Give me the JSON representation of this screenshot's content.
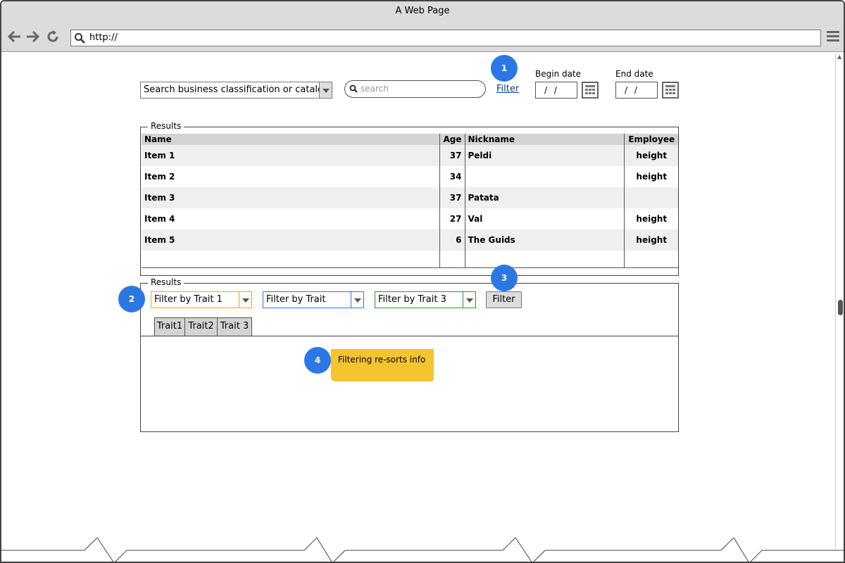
{
  "window": {
    "title": "A Web Page",
    "url": "http://"
  },
  "toolbar": {
    "classification_select": "Search business classification or catalog",
    "search_placeholder": "search",
    "filter_link": "Filter",
    "begin_date_label": "Begin date",
    "begin_date_value": "/ /",
    "end_date_label": "End date",
    "end_date_value": "/ /"
  },
  "results_table": {
    "legend": "Results",
    "columns": [
      "Name",
      "Age",
      "Nickname",
      "Employee"
    ],
    "rows": [
      {
        "name": "Item 1",
        "age": "37",
        "nickname": "Peldi",
        "employee": "height"
      },
      {
        "name": "Item 2",
        "age": "34",
        "nickname": "",
        "employee": "height"
      },
      {
        "name": "Item 3",
        "age": "37",
        "nickname": "Patata",
        "employee": ""
      },
      {
        "name": "Item 4",
        "age": "27",
        "nickname": "Val",
        "employee": "height"
      },
      {
        "name": "Item 5",
        "age": "6",
        "nickname": "The Guids",
        "employee": "height"
      }
    ]
  },
  "filters": {
    "legend": "Results",
    "trait1": "Filter by Trait 1",
    "trait2": "Filter by Trait",
    "trait3": "Filter by Trait 3",
    "filter_button": "Filter",
    "tabs": [
      "Trait1",
      "Trait2",
      "Trait 3"
    ]
  },
  "annotations": {
    "b1": "1",
    "b2": "2",
    "b3": "3",
    "b4": "4",
    "sticky_note": "Filtering re-sorts info"
  },
  "colors": {
    "bubble": "#2b78e4",
    "trait1_accent": "#f0a030",
    "trait2_accent": "#2b78e4",
    "trait3_accent": "#22a022",
    "sticky": "#f4c430"
  },
  "icons": [
    "back-arrow-icon",
    "forward-arrow-icon",
    "reload-icon",
    "search-icon",
    "hamburger-menu-icon",
    "calendar-icon",
    "dropdown-arrow-icon"
  ]
}
